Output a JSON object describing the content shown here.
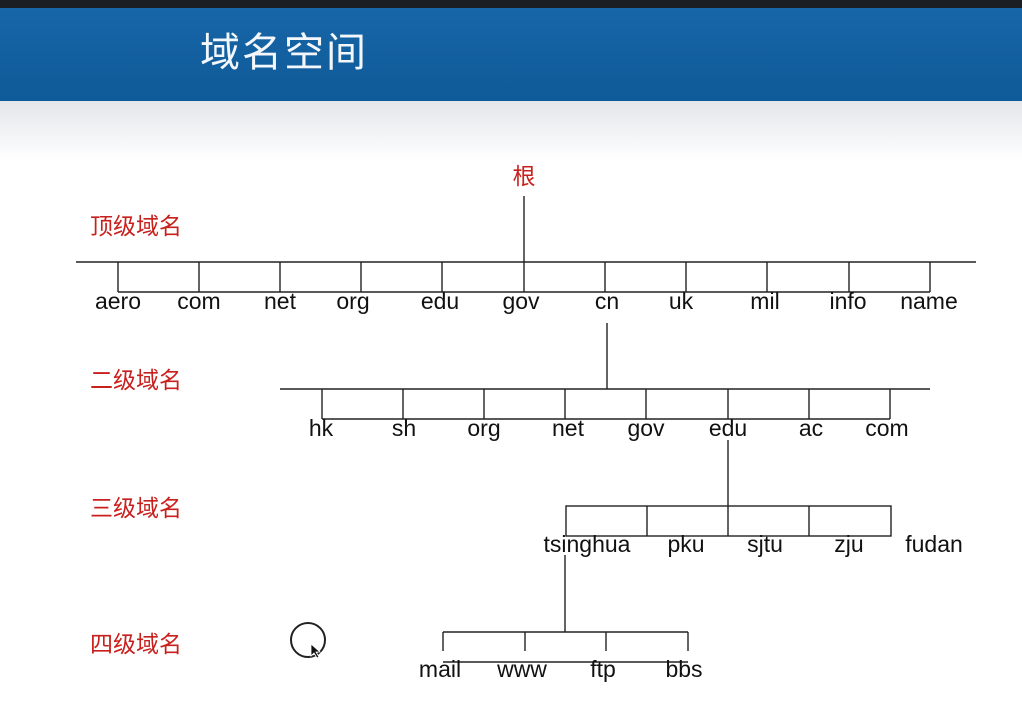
{
  "title": "域名空间",
  "root": "根",
  "levels": [
    {
      "label": "顶级域名",
      "nodes": [
        "aero",
        "com",
        "net",
        "org",
        "edu",
        "gov",
        "cn",
        "uk",
        "mil",
        "info",
        "name"
      ]
    },
    {
      "label": "二级域名",
      "nodes": [
        "hk",
        "sh",
        "org",
        "net",
        "gov",
        "edu",
        "ac",
        "com"
      ]
    },
    {
      "label": "三级域名",
      "nodes": [
        "tsinghua",
        "pku",
        "sjtu",
        "zju",
        "fudan"
      ]
    },
    {
      "label": "四级域名",
      "nodes": [
        "mail",
        "www",
        "ftp",
        "bbs"
      ]
    }
  ],
  "colors": {
    "header": "#1766a8",
    "level_label": "#c8201c",
    "root_label": "#c8201c",
    "line": "#222222"
  },
  "icons": [
    "cursor-icon"
  ]
}
